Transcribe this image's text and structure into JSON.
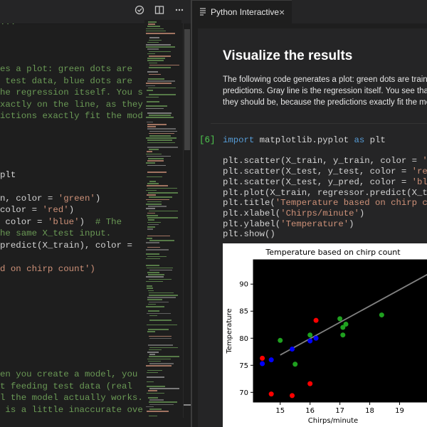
{
  "left_editor": {
    "lines": [
      {
        "segments": [
          {
            "t": "...",
            "c": "c-comment"
          }
        ]
      },
      {
        "segments": []
      },
      {
        "segments": []
      },
      {
        "segments": []
      },
      {
        "segments": [
          {
            "t": "es a plot: green dots are",
            "c": "c-comment"
          }
        ]
      },
      {
        "segments": [
          {
            "t": " test data, blue dots are",
            "c": "c-comment"
          }
        ]
      },
      {
        "segments": [
          {
            "t": "he regression itself. You see",
            "c": "c-comment"
          }
        ]
      },
      {
        "segments": [
          {
            "t": "xactly on the line, as they",
            "c": "c-comment"
          }
        ]
      },
      {
        "segments": [
          {
            "t": "ictions exactly fit the model",
            "c": "c-comment"
          }
        ]
      },
      {
        "segments": []
      },
      {
        "segments": []
      },
      {
        "segments": []
      },
      {
        "segments": []
      },
      {
        "segments": [
          {
            "t": "plt",
            "c": ""
          }
        ]
      },
      {
        "segments": []
      },
      {
        "segments": [
          {
            "t": "n, color = ",
            "c": ""
          },
          {
            "t": "'green'",
            "c": "c-str"
          },
          {
            "t": ")",
            "c": ""
          }
        ]
      },
      {
        "segments": [
          {
            "t": "color = ",
            "c": ""
          },
          {
            "t": "'red'",
            "c": "c-str"
          },
          {
            "t": ")",
            "c": ""
          }
        ]
      },
      {
        "segments": [
          {
            "t": " color = ",
            "c": ""
          },
          {
            "t": "'blue'",
            "c": "c-str"
          },
          {
            "t": ")  ",
            "c": ""
          },
          {
            "t": "# The",
            "c": "c-comment"
          }
        ]
      },
      {
        "segments": [
          {
            "t": "he same X_test input.",
            "c": "c-comment"
          }
        ]
      },
      {
        "segments": [
          {
            "t": "predict(X_train), color =",
            "c": ""
          }
        ]
      },
      {
        "segments": []
      },
      {
        "segments": [
          {
            "t": "d on chirp count')",
            "c": "c-str"
          }
        ]
      },
      {
        "segments": []
      },
      {
        "segments": []
      },
      {
        "segments": []
      },
      {
        "segments": []
      },
      {
        "segments": []
      },
      {
        "segments": []
      },
      {
        "segments": []
      },
      {
        "segments": []
      },
      {
        "segments": [
          {
            "t": "en you create a model, you use",
            "c": "c-comment"
          }
        ]
      },
      {
        "segments": [
          {
            "t": "t feeding test data (real",
            "c": "c-comment"
          }
        ]
      },
      {
        "segments": [
          {
            "t": "l the model actually works.",
            "c": "c-comment"
          }
        ]
      },
      {
        "segments": [
          {
            "t": " is a little inaccurate over",
            "c": "c-comment"
          }
        ]
      }
    ]
  },
  "left_header": {
    "icons": [
      "check-circle-icon",
      "split-editor-icon",
      "more-actions-icon"
    ]
  },
  "tab": {
    "label": "Python Interactive",
    "icon": "document-icon",
    "close": "×"
  },
  "markdown_cell": {
    "title": "Visualize the results",
    "text_lines": [
      "The following code generates a plot: green dots are trainin",
      "predictions. Gray line is the regression itself. You see that",
      "they should be, because the predictions exactly fit the mo"
    ]
  },
  "code_cell": {
    "execution_count": "[6]",
    "lines": [
      [
        {
          "t": "import",
          "c": "c-kw"
        },
        {
          "t": " matplotlib.pyplot ",
          "c": ""
        },
        {
          "t": "as",
          "c": "c-kw"
        },
        {
          "t": " plt",
          "c": ""
        }
      ],
      [],
      [
        {
          "t": "plt.scatter(X_train, y_train, color = ",
          "c": ""
        },
        {
          "t": "'gree",
          "c": "c-str"
        }
      ],
      [
        {
          "t": "plt.scatter(X_test, y_test, color = ",
          "c": ""
        },
        {
          "t": "'red'",
          "c": "c-str"
        },
        {
          "t": ")",
          "c": ""
        }
      ],
      [
        {
          "t": "plt.scatter(X_test, y_pred, color = ",
          "c": ""
        },
        {
          "t": "'blue'",
          "c": "c-str"
        },
        {
          "t": ")",
          "c": ""
        }
      ],
      [
        {
          "t": "plt.plot(X_train, regressor.predict(X_train",
          "c": ""
        }
      ],
      [
        {
          "t": "plt.title(",
          "c": ""
        },
        {
          "t": "'Temperature based on chirp count",
          "c": "c-str"
        }
      ],
      [
        {
          "t": "plt.xlabel(",
          "c": ""
        },
        {
          "t": "'Chirps/minute'",
          "c": "c-str"
        },
        {
          "t": ")",
          "c": ""
        }
      ],
      [
        {
          "t": "plt.ylabel(",
          "c": ""
        },
        {
          "t": "'Temperature'",
          "c": "c-str"
        },
        {
          "t": ")",
          "c": ""
        }
      ],
      [
        {
          "t": "plt.show()",
          "c": ""
        }
      ]
    ]
  },
  "chart_data": {
    "type": "scatter",
    "title": "Temperature based on chirp count",
    "xlabel": "Chirps/minute",
    "ylabel": "Temperature",
    "xlim": [
      14.1,
      20.3
    ],
    "ylim": [
      68.2,
      94.5
    ],
    "xticks": [
      15,
      16,
      17,
      18,
      19
    ],
    "yticks": [
      70,
      75,
      80,
      85,
      90
    ],
    "series": [
      {
        "color": "#1fa01f",
        "points": [
          [
            15.0,
            79.6
          ],
          [
            15.5,
            75.2
          ],
          [
            16.0,
            80.6
          ],
          [
            17.0,
            83.6
          ],
          [
            17.1,
            82.0
          ],
          [
            17.1,
            80.6
          ],
          [
            17.2,
            82.6
          ],
          [
            18.4,
            84.3
          ]
        ]
      },
      {
        "color": "#ff0000",
        "points": [
          [
            14.4,
            76.3
          ],
          [
            14.7,
            69.7
          ],
          [
            15.4,
            69.4
          ],
          [
            16.0,
            71.6
          ],
          [
            16.2,
            83.3
          ]
        ]
      },
      {
        "color": "#0000ff",
        "points": [
          [
            14.4,
            75.3
          ],
          [
            14.7,
            76.0
          ],
          [
            15.4,
            78.0
          ],
          [
            16.0,
            79.5
          ],
          [
            16.2,
            80.0
          ]
        ]
      }
    ],
    "line": {
      "color": "#808080",
      "points": [
        [
          15.0,
          76.9
        ],
        [
          20.3,
          92.9
        ]
      ]
    }
  }
}
